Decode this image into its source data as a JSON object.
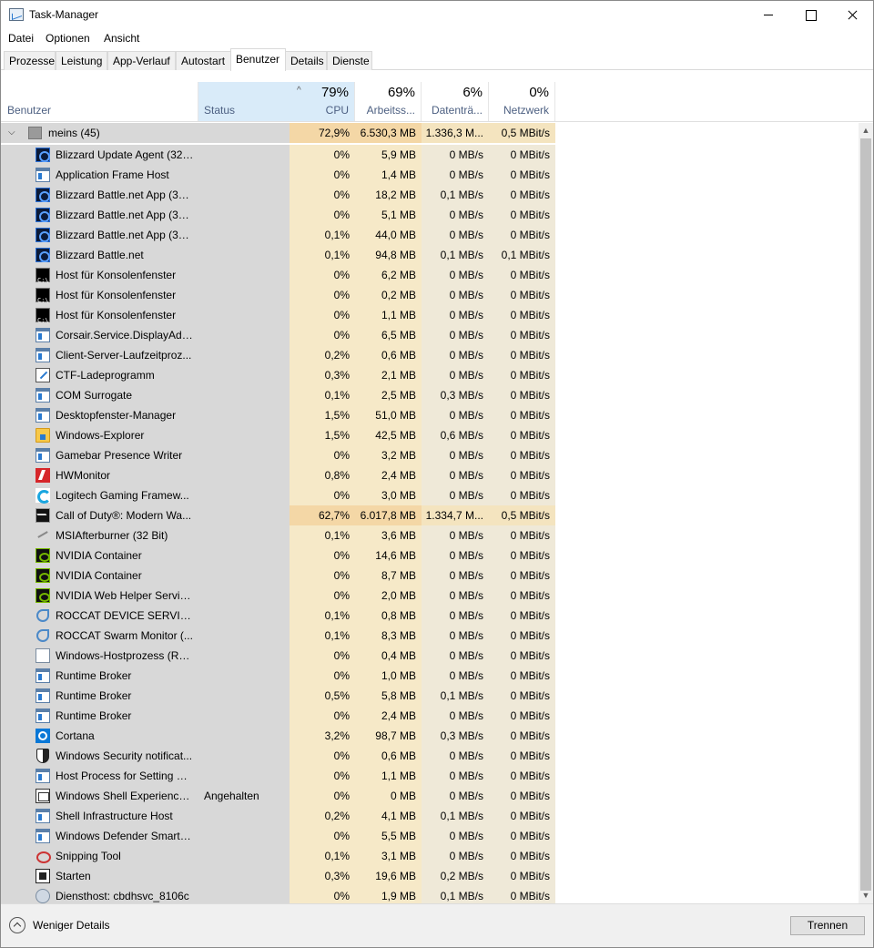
{
  "window": {
    "title": "Task-Manager"
  },
  "menu": [
    "Datei",
    "Optionen",
    "Ansicht"
  ],
  "tabs": [
    "Prozesse",
    "Leistung",
    "App-Verlauf",
    "Autostart",
    "Benutzer",
    "Details",
    "Dienste"
  ],
  "active_tab": "Benutzer",
  "header": {
    "user": "Benutzer",
    "status": "Status",
    "cpu": {
      "pct": "79%",
      "label": "CPU"
    },
    "mem": {
      "pct": "69%",
      "label": "Arbeitss..."
    },
    "disk": {
      "pct": "6%",
      "label": "Datenträ..."
    },
    "net": {
      "pct": "0%",
      "label": "Netzwerk"
    }
  },
  "group": {
    "label": "meins (45)",
    "cpu": "72,9%",
    "mem": "6.530,3 MB",
    "disk": "1.336,3 M...",
    "net": "0,5 MBit/s"
  },
  "processes": [
    {
      "icon": "blizzard-icon",
      "name": "Blizzard Update Agent (32 ...",
      "status": "",
      "cpu": "0%",
      "mem": "5,9 MB",
      "disk": "0 MB/s",
      "net": "0 MBit/s"
    },
    {
      "icon": "window-icon",
      "name": "Application Frame Host",
      "status": "",
      "cpu": "0%",
      "mem": "1,4 MB",
      "disk": "0 MB/s",
      "net": "0 MBit/s"
    },
    {
      "icon": "battlenet-icon",
      "name": "Blizzard Battle.net App (32 ...",
      "status": "",
      "cpu": "0%",
      "mem": "18,2 MB",
      "disk": "0,1 MB/s",
      "net": "0 MBit/s"
    },
    {
      "icon": "battlenet-icon",
      "name": "Blizzard Battle.net App (32 ...",
      "status": "",
      "cpu": "0%",
      "mem": "5,1 MB",
      "disk": "0 MB/s",
      "net": "0 MBit/s"
    },
    {
      "icon": "battlenet-icon",
      "name": "Blizzard Battle.net App (32 ...",
      "status": "",
      "cpu": "0,1%",
      "mem": "44,0 MB",
      "disk": "0 MB/s",
      "net": "0 MBit/s"
    },
    {
      "icon": "battlenet-icon",
      "name": "Blizzard Battle.net",
      "status": "",
      "cpu": "0,1%",
      "mem": "94,8 MB",
      "disk": "0,1 MB/s",
      "net": "0,1 MBit/s"
    },
    {
      "icon": "console-icon",
      "name": "Host für Konsolenfenster",
      "status": "",
      "cpu": "0%",
      "mem": "6,2 MB",
      "disk": "0 MB/s",
      "net": "0 MBit/s"
    },
    {
      "icon": "console-icon",
      "name": "Host für Konsolenfenster",
      "status": "",
      "cpu": "0%",
      "mem": "0,2 MB",
      "disk": "0 MB/s",
      "net": "0 MBit/s"
    },
    {
      "icon": "console-icon",
      "name": "Host für Konsolenfenster",
      "status": "",
      "cpu": "0%",
      "mem": "1,1 MB",
      "disk": "0 MB/s",
      "net": "0 MBit/s"
    },
    {
      "icon": "window-icon",
      "name": "Corsair.Service.DisplayAda...",
      "status": "",
      "cpu": "0%",
      "mem": "6,5 MB",
      "disk": "0 MB/s",
      "net": "0 MBit/s"
    },
    {
      "icon": "window-icon",
      "name": "Client-Server-Laufzeitproz...",
      "status": "",
      "cpu": "0,2%",
      "mem": "0,6 MB",
      "disk": "0 MB/s",
      "net": "0 MBit/s"
    },
    {
      "icon": "ctf-icon",
      "name": "CTF-Ladeprogramm",
      "status": "",
      "cpu": "0,3%",
      "mem": "2,1 MB",
      "disk": "0 MB/s",
      "net": "0 MBit/s"
    },
    {
      "icon": "window-icon",
      "name": "COM Surrogate",
      "status": "",
      "cpu": "0,1%",
      "mem": "2,5 MB",
      "disk": "0,3 MB/s",
      "net": "0 MBit/s"
    },
    {
      "icon": "window-icon",
      "name": "Desktopfenster-Manager",
      "status": "",
      "cpu": "1,5%",
      "mem": "51,0 MB",
      "disk": "0 MB/s",
      "net": "0 MBit/s"
    },
    {
      "icon": "folder-icon",
      "name": "Windows-Explorer",
      "status": "",
      "cpu": "1,5%",
      "mem": "42,5 MB",
      "disk": "0,6 MB/s",
      "net": "0 MBit/s"
    },
    {
      "icon": "window-icon",
      "name": "Gamebar Presence Writer",
      "status": "",
      "cpu": "0%",
      "mem": "3,2 MB",
      "disk": "0 MB/s",
      "net": "0 MBit/s"
    },
    {
      "icon": "hwmonitor-icon",
      "name": "HWMonitor",
      "status": "",
      "cpu": "0,8%",
      "mem": "2,4 MB",
      "disk": "0 MB/s",
      "net": "0 MBit/s"
    },
    {
      "icon": "logitech-icon",
      "name": "Logitech Gaming Framew...",
      "status": "",
      "cpu": "0%",
      "mem": "3,0 MB",
      "disk": "0 MB/s",
      "net": "0 MBit/s"
    },
    {
      "icon": "cod-icon",
      "name": "Call of Duty®: Modern Wa...",
      "status": "",
      "cpu": "62,7%",
      "mem": "6.017,8 MB",
      "disk": "1.334,7 M...",
      "net": "0,5 MBit/s",
      "hot": true
    },
    {
      "icon": "msi-icon",
      "name": "MSIAfterburner (32 Bit)",
      "status": "",
      "cpu": "0,1%",
      "mem": "3,6 MB",
      "disk": "0 MB/s",
      "net": "0 MBit/s"
    },
    {
      "icon": "nvidia-icon",
      "name": "NVIDIA Container",
      "status": "",
      "cpu": "0%",
      "mem": "14,6 MB",
      "disk": "0 MB/s",
      "net": "0 MBit/s"
    },
    {
      "icon": "nvidia-icon",
      "name": "NVIDIA Container",
      "status": "",
      "cpu": "0%",
      "mem": "8,7 MB",
      "disk": "0 MB/s",
      "net": "0 MBit/s"
    },
    {
      "icon": "nvidia-icon",
      "name": "NVIDIA Web Helper Servic...",
      "status": "",
      "cpu": "0%",
      "mem": "2,0 MB",
      "disk": "0 MB/s",
      "net": "0 MBit/s"
    },
    {
      "icon": "roccat-icon",
      "name": "ROCCAT DEVICE SERVICE (...",
      "status": "",
      "cpu": "0,1%",
      "mem": "0,8 MB",
      "disk": "0 MB/s",
      "net": "0 MBit/s"
    },
    {
      "icon": "roccat-icon",
      "name": "ROCCAT Swarm Monitor (...",
      "status": "",
      "cpu": "0,1%",
      "mem": "8,3 MB",
      "disk": "0 MB/s",
      "net": "0 MBit/s"
    },
    {
      "icon": "document-icon",
      "name": "Windows-Hostprozess (Ru...",
      "status": "",
      "cpu": "0%",
      "mem": "0,4 MB",
      "disk": "0 MB/s",
      "net": "0 MBit/s"
    },
    {
      "icon": "window-icon",
      "name": "Runtime Broker",
      "status": "",
      "cpu": "0%",
      "mem": "1,0 MB",
      "disk": "0 MB/s",
      "net": "0 MBit/s"
    },
    {
      "icon": "window-icon",
      "name": "Runtime Broker",
      "status": "",
      "cpu": "0,5%",
      "mem": "5,8 MB",
      "disk": "0,1 MB/s",
      "net": "0 MBit/s"
    },
    {
      "icon": "window-icon",
      "name": "Runtime Broker",
      "status": "",
      "cpu": "0%",
      "mem": "2,4 MB",
      "disk": "0 MB/s",
      "net": "0 MBit/s"
    },
    {
      "icon": "cortana-icon",
      "name": "Cortana",
      "status": "",
      "cpu": "3,2%",
      "mem": "98,7 MB",
      "disk": "0,3 MB/s",
      "net": "0 MBit/s"
    },
    {
      "icon": "shield-icon",
      "name": "Windows Security notificat...",
      "status": "",
      "cpu": "0%",
      "mem": "0,6 MB",
      "disk": "0 MB/s",
      "net": "0 MBit/s"
    },
    {
      "icon": "window-icon",
      "name": "Host Process for Setting Sy...",
      "status": "",
      "cpu": "0%",
      "mem": "1,1 MB",
      "disk": "0 MB/s",
      "net": "0 MBit/s"
    },
    {
      "icon": "shell-experience-icon",
      "name": "Windows Shell Experience ...",
      "status": "Angehalten",
      "cpu": "0%",
      "mem": "0 MB",
      "disk": "0 MB/s",
      "net": "0 MBit/s"
    },
    {
      "icon": "window-icon",
      "name": "Shell Infrastructure Host",
      "status": "",
      "cpu": "0,2%",
      "mem": "4,1 MB",
      "disk": "0,1 MB/s",
      "net": "0 MBit/s"
    },
    {
      "icon": "window-icon",
      "name": "Windows Defender SmartS...",
      "status": "",
      "cpu": "0%",
      "mem": "5,5 MB",
      "disk": "0 MB/s",
      "net": "0 MBit/s"
    },
    {
      "icon": "snipping-icon",
      "name": "Snipping Tool",
      "status": "",
      "cpu": "0,1%",
      "mem": "3,1 MB",
      "disk": "0 MB/s",
      "net": "0 MBit/s"
    },
    {
      "icon": "start-icon",
      "name": "Starten",
      "status": "",
      "cpu": "0,3%",
      "mem": "19,6 MB",
      "disk": "0,2 MB/s",
      "net": "0 MBit/s"
    },
    {
      "icon": "gear-icon",
      "name": "Diensthost: cbdhsvc_8106c",
      "status": "",
      "cpu": "0%",
      "mem": "1,9 MB",
      "disk": "0,1 MB/s",
      "net": "0 MBit/s"
    }
  ],
  "footer": {
    "toggle_label": "Weniger Details",
    "button_label": "Trennen"
  }
}
